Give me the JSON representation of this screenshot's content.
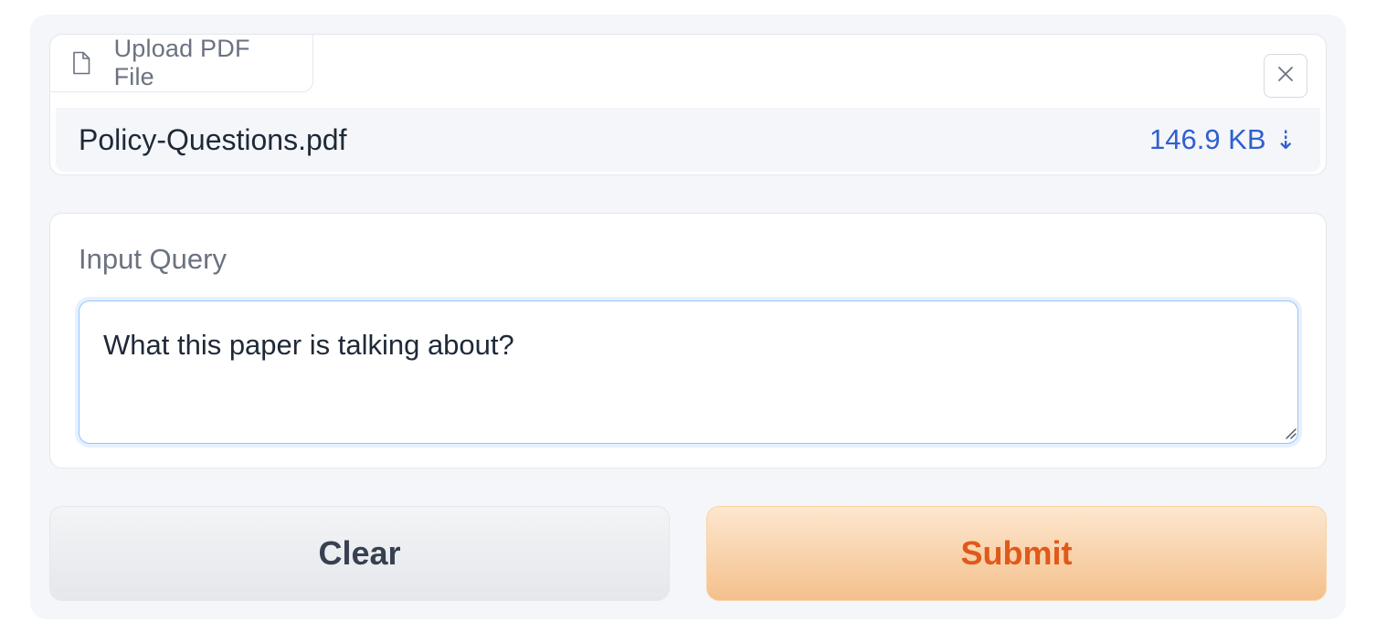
{
  "upload": {
    "label": "Upload PDF File",
    "file_name": "Policy-Questions.pdf",
    "file_size": "146.9 KB",
    "download_glyph": "⇣",
    "icons": {
      "file": "file-icon",
      "close": "close-icon",
      "download": "download-icon"
    }
  },
  "query": {
    "label": "Input Query",
    "value": "What this paper is talking about?"
  },
  "buttons": {
    "clear_label": "Clear",
    "submit_label": "Submit"
  },
  "colors": {
    "accent_blue": "#2f5fd0",
    "submit_text": "#e0591b",
    "submit_bg": "#f4c08c",
    "focus_border": "#93c5fd"
  }
}
